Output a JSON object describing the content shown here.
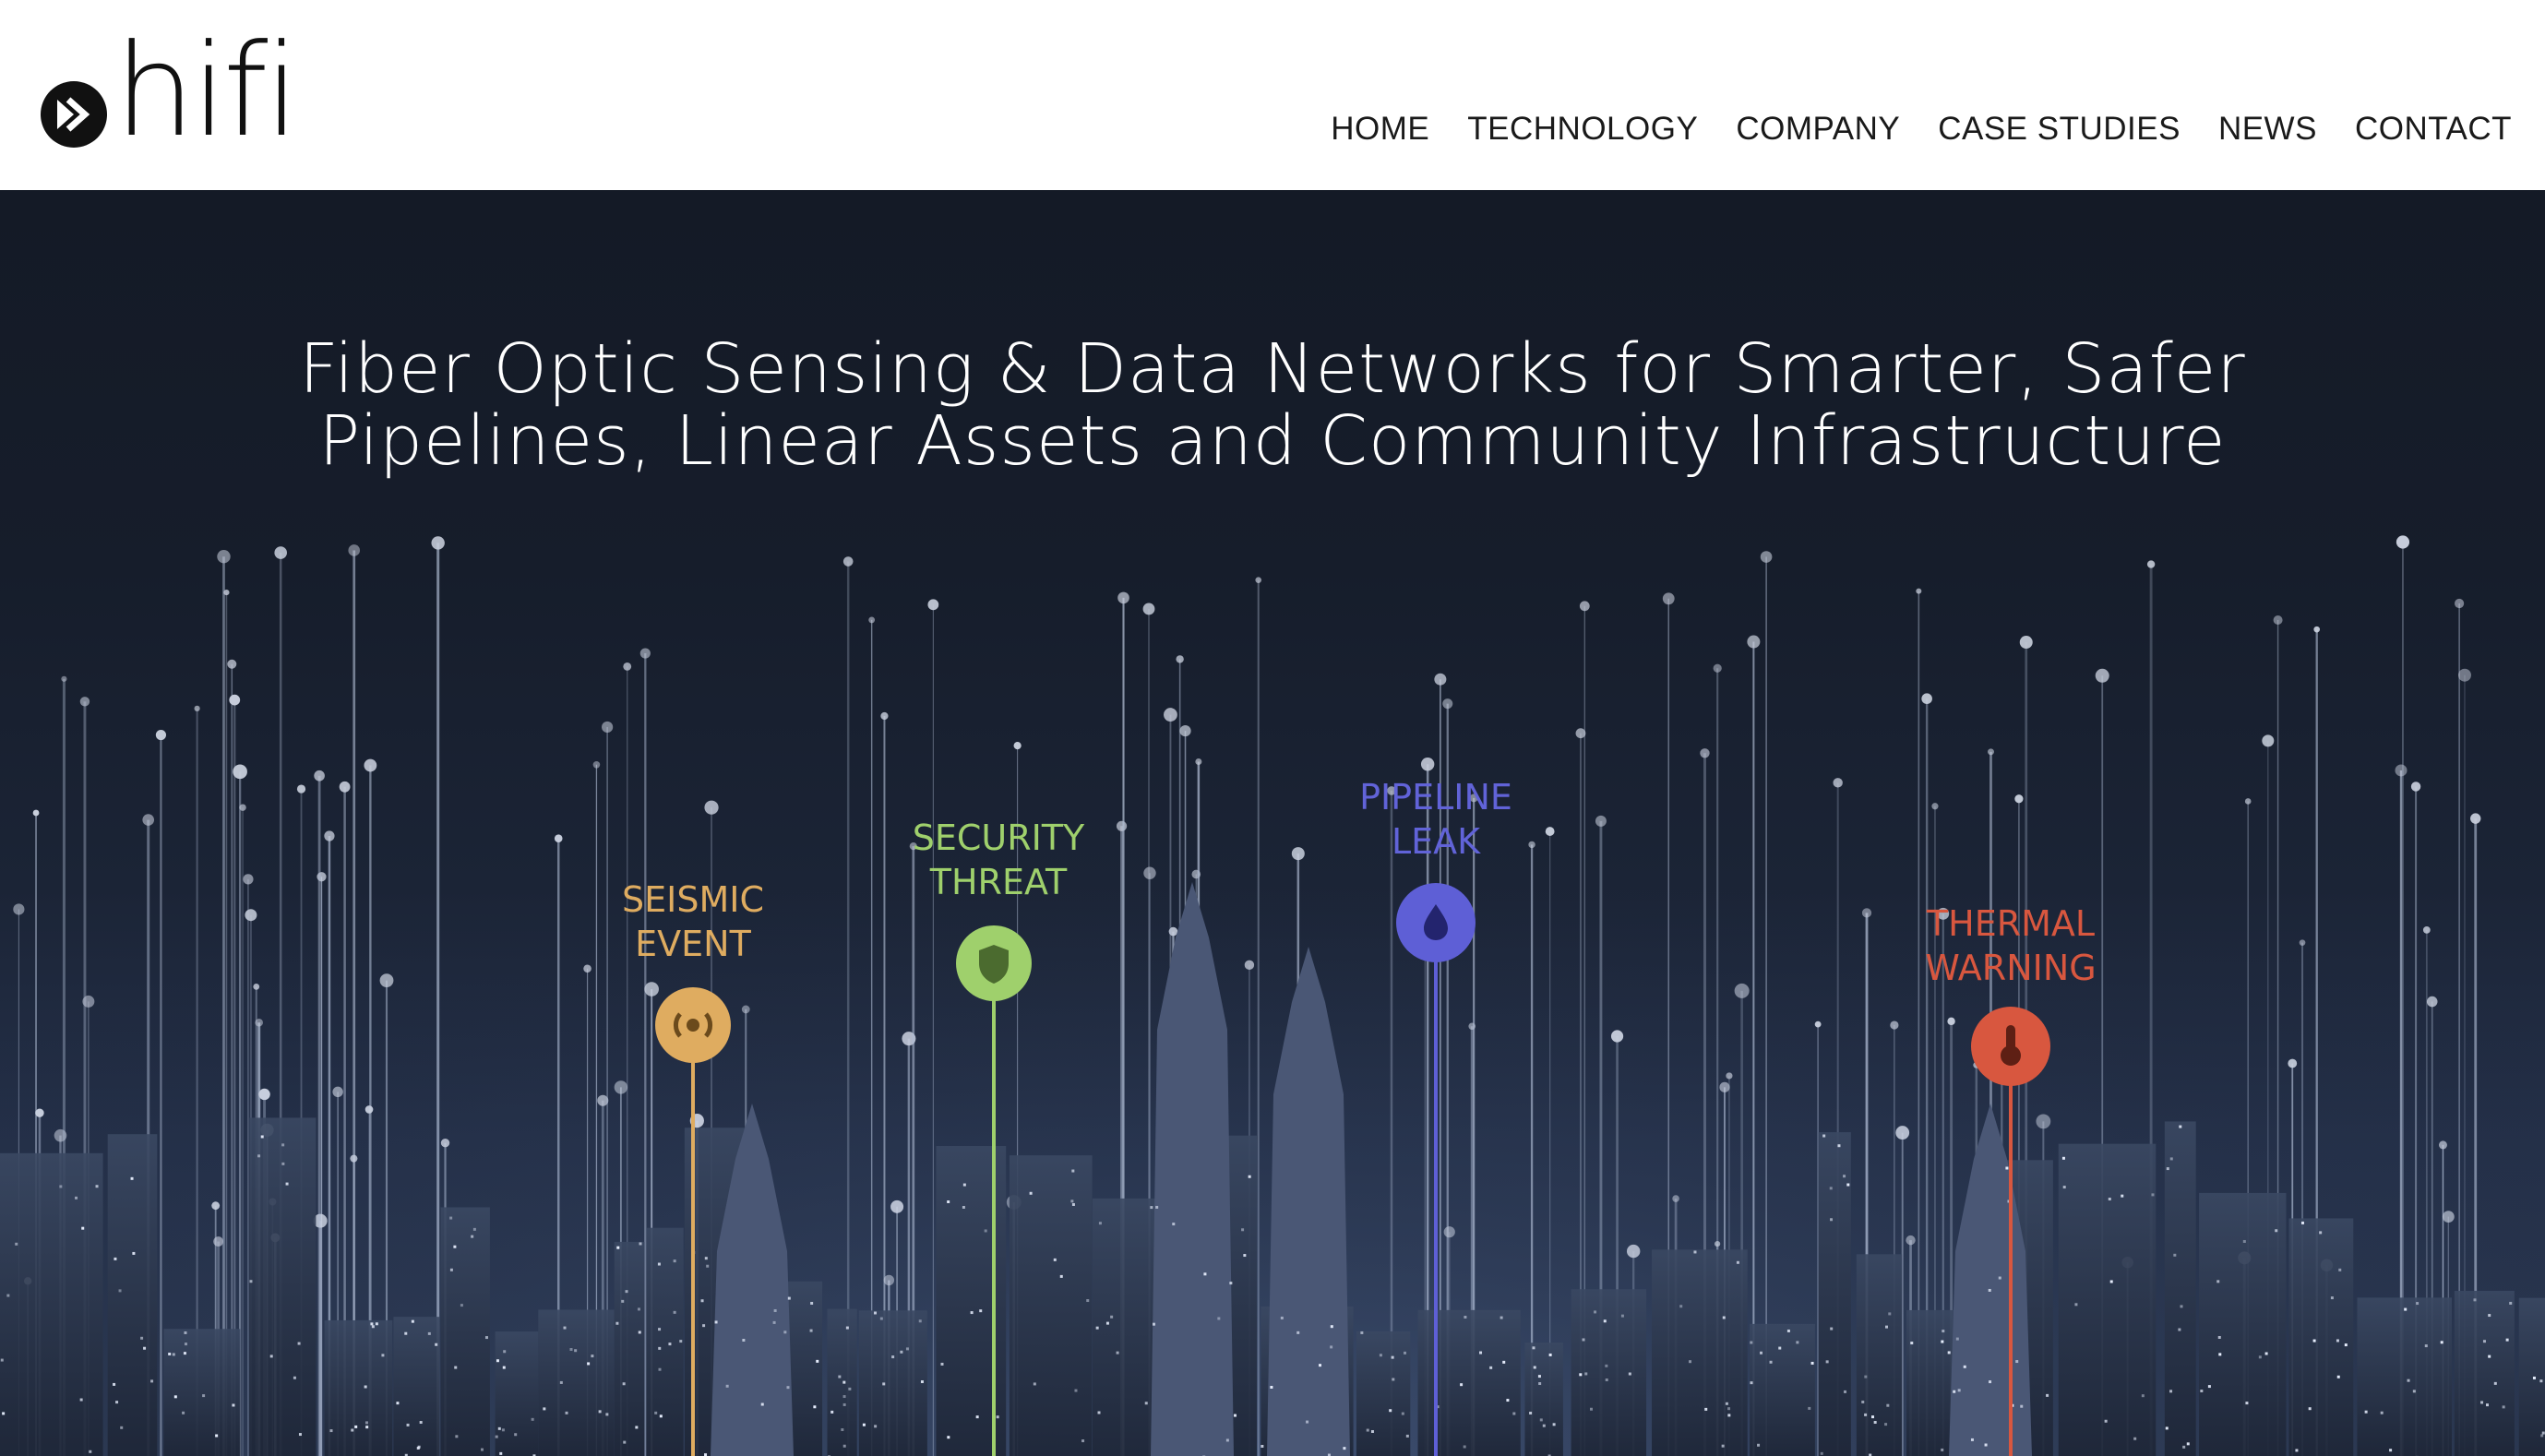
{
  "brand": {
    "name": "hifi"
  },
  "nav": {
    "items": [
      {
        "label": "HOME"
      },
      {
        "label": "TECHNOLOGY"
      },
      {
        "label": "COMPANY"
      },
      {
        "label": "CASE STUDIES"
      },
      {
        "label": "NEWS"
      },
      {
        "label": "CONTACT"
      }
    ]
  },
  "hero": {
    "title_line1": "Fiber Optic Sensing & Data Networks for Smarter, Safer",
    "title_line2": "Pipelines, Linear Assets and Community Infrastructure"
  },
  "markers": [
    {
      "line1": "SEISMIC",
      "line2": "EVENT",
      "icon": "broadcast-icon",
      "color": "#dfac60"
    },
    {
      "line1": "SECURITY",
      "line2": "THREAT",
      "icon": "shield-icon",
      "color": "#9fd06c"
    },
    {
      "line1": "PIPELINE",
      "line2": "LEAK",
      "icon": "droplet-icon",
      "color": "#5e5fd6"
    },
    {
      "line1": "THERMAL",
      "line2": "WARNING",
      "icon": "thermometer-icon",
      "color": "#d8573f"
    }
  ],
  "colors": {
    "hero_bg": "#161d2b",
    "header_bg": "#ffffff",
    "nav_text": "#1a1a1a"
  }
}
